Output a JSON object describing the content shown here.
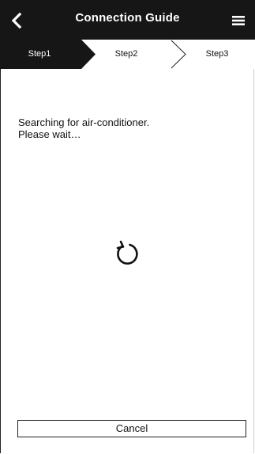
{
  "header": {
    "title": "Connection Guide",
    "back_icon": "chevron-left-icon",
    "menu_icon": "hamburger-menu-icon"
  },
  "steps": [
    {
      "label": "Step1",
      "active": true
    },
    {
      "label": "Step2",
      "active": false
    },
    {
      "label": "Step3",
      "active": false
    }
  ],
  "main": {
    "message_line1": "Searching for air-conditioner.",
    "message_line2": "Please wait…",
    "spinner_icon": "refresh-icon"
  },
  "footer": {
    "cancel_label": "Cancel"
  },
  "colors": {
    "header_bg": "#161616",
    "active_step_bg": "#161616",
    "text": "#111111"
  }
}
